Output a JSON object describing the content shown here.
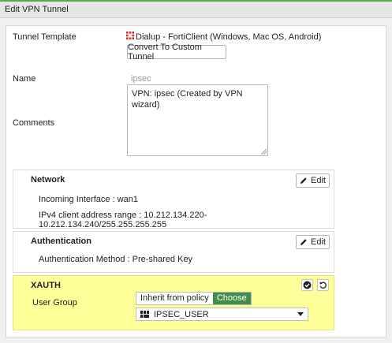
{
  "window": {
    "title": "Edit VPN Tunnel"
  },
  "colors": {
    "accent": "#58a94b",
    "toggle_active": "#3f8f4a",
    "xauth_bg": "#ffff9a",
    "fortinet_red": "#e02b2b"
  },
  "form": {
    "tunnel_template": {
      "label": "Tunnel Template",
      "value": "Dialup - FortiClient (Windows, Mac OS, Android)",
      "icon": "fortinet-logo-icon",
      "button": "Convert To Custom Tunnel"
    },
    "name": {
      "label": "Name",
      "value": "ipsec"
    },
    "comments": {
      "label": "Comments",
      "value": "VPN: ipsec (Created by VPN wizard)"
    }
  },
  "network": {
    "title": "Network",
    "edit_label": "Edit",
    "incoming_interface": "Incoming Interface : wan1",
    "client_range": "IPv4 client address range : 10.212.134.220-10.212.134.240/255.255.255.255"
  },
  "authentication": {
    "title": "Authentication",
    "edit_label": "Edit",
    "method": "Authentication Method : Pre-shared Key"
  },
  "xauth": {
    "title": "XAUTH",
    "user_group_label": "User Group",
    "toggle": {
      "options": [
        "Inherit from policy",
        "Choose"
      ],
      "selected": "Choose"
    },
    "group_select": {
      "value": "IPSEC_USER",
      "icon": "user-group-icon"
    }
  }
}
